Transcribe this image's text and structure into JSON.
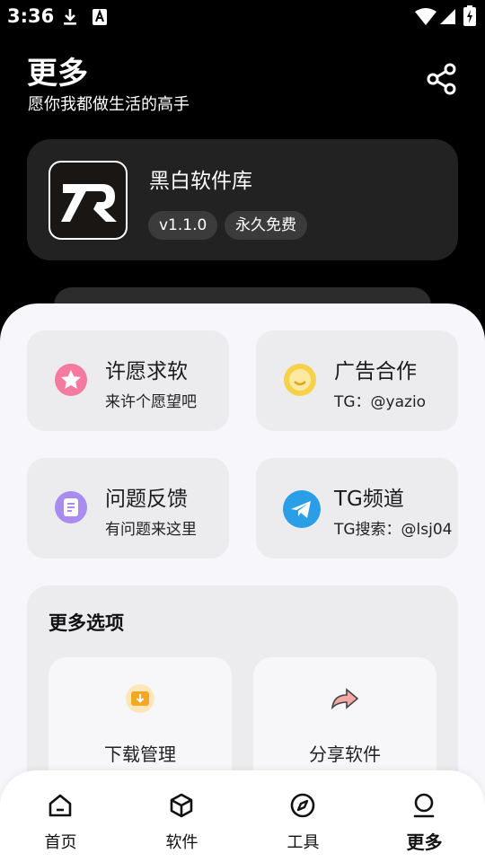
{
  "status_bar": {
    "time": "3:36"
  },
  "header": {
    "title": "更多",
    "subtitle": "愿你我都做生活的高手"
  },
  "app_card": {
    "name": "黑白软件库",
    "version": "v1.1.0",
    "tag": "永久免费"
  },
  "quick_tiles": [
    {
      "title": "许愿求软",
      "subtitle": "来许个愿望吧",
      "icon": "star-icon"
    },
    {
      "title": "广告合作",
      "subtitle": "TG：@yazio",
      "icon": "smile-icon"
    },
    {
      "title": "问题反馈",
      "subtitle": "有问题来这里",
      "icon": "feedback-icon"
    },
    {
      "title": "TG频道",
      "subtitle": "TG搜索：@lsj04",
      "icon": "telegram-icon"
    }
  ],
  "more_options": {
    "title": "更多选项",
    "items": [
      {
        "label": "下载管理",
        "icon": "download-folder-icon"
      },
      {
        "label": "分享软件",
        "icon": "share-arrow-icon"
      }
    ]
  },
  "tabbar": {
    "items": [
      {
        "label": "首页",
        "icon": "home-icon"
      },
      {
        "label": "软件",
        "icon": "cube-icon"
      },
      {
        "label": "工具",
        "icon": "compass-icon"
      },
      {
        "label": "更多",
        "icon": "profile-icon"
      }
    ],
    "active_index": 3
  },
  "colors": {
    "background": "#000000",
    "sheet": "#f6f6fb",
    "card": "#222222",
    "tile": "#ececef"
  }
}
